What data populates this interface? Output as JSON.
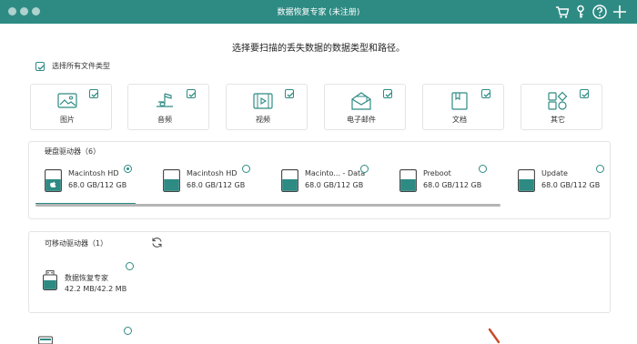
{
  "window": {
    "title": "数据恢复专家 (未注册)"
  },
  "toolbar_icons": [
    "cart-icon",
    "key-icon",
    "help-icon",
    "plus-icon"
  ],
  "headline": "选择要扫描的丢失数据的数据类型和路径。",
  "select_all": {
    "label": "选择所有文件类型",
    "checked": true
  },
  "file_types": [
    {
      "label": "图片",
      "icon": "image-icon",
      "checked": true
    },
    {
      "label": "音频",
      "icon": "music-icon",
      "checked": true
    },
    {
      "label": "视频",
      "icon": "video-icon",
      "checked": true
    },
    {
      "label": "电子邮件",
      "icon": "email-icon",
      "checked": true
    },
    {
      "label": "文档",
      "icon": "document-icon",
      "checked": true
    },
    {
      "label": "其它",
      "icon": "shapes-icon",
      "checked": true
    }
  ],
  "hard_drives": {
    "title": "硬盘驱动器（6）",
    "items": [
      {
        "name": "Macintosh HD",
        "size": "68.0 GB/112 GB",
        "selected": true,
        "apple": true
      },
      {
        "name": "Macintosh HD",
        "size": "68.0 GB/112 GB",
        "selected": false
      },
      {
        "name": "Macinto... - Data",
        "size": "68.0 GB/112 GB",
        "selected": false
      },
      {
        "name": "Preboot",
        "size": "68.0 GB/112 GB",
        "selected": false
      },
      {
        "name": "Update",
        "size": "68.0 GB/112 GB",
        "selected": false
      }
    ]
  },
  "removable": {
    "title": "可移动驱动器（1）",
    "items": [
      {
        "name": "数据恢复专家",
        "size": "42.2 MB/42.2 MB",
        "selected": false
      }
    ]
  },
  "colors": {
    "accent": "#2e8b84",
    "titlebar": "#2e8b84"
  }
}
